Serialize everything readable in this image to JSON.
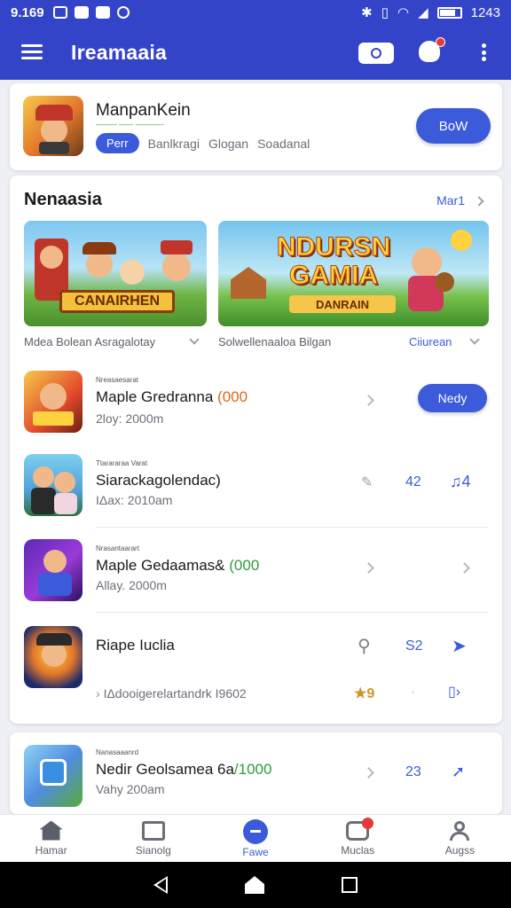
{
  "status_bar": {
    "time": "9.169",
    "clock": "1243"
  },
  "app_bar": {
    "title": "Ireamaaia"
  },
  "featured": {
    "title": "ManpanKein",
    "subtitle": "——— —— ————",
    "tag_pill": "Perr",
    "tags": [
      "Banlkragi",
      "Glogan",
      "Soadanal"
    ],
    "button": "BoW"
  },
  "section": {
    "title": "Nenaasia",
    "more": "Mar1",
    "banners": [
      {
        "plaque": "CANAIRHEN",
        "caption": "Mdea Bolean Asragalotay"
      },
      {
        "headline": "NDURSN GAMIA",
        "ribbon": "DANRAIN",
        "caption": "Solwellenaaloa Bilgan",
        "link": "Ciiurean"
      }
    ],
    "rows": [
      {
        "small": "Nreasaesarat",
        "title": "Maple Gredranna",
        "title_accent": "(000",
        "meta": "2loy: 2000m",
        "button": "Nedy"
      },
      {
        "small": "Ttarararaa Varat",
        "title": "Siarackagolendac)",
        "meta": "IΔax: 2010am",
        "num1": "42",
        "num2": "♫4"
      },
      {
        "small": "Nrasantaarart",
        "title": "Maple Gedaamas&",
        "title_accent": "(000",
        "meta": "Allay. 2000m"
      },
      {
        "title": "Riape Iuclia",
        "num1": "S2",
        "detail": "IΔdooigerelartandrk I9602",
        "rating": "★9"
      }
    ]
  },
  "bottom_card": {
    "small": "Nanasaaanrd",
    "title": "Nedir Geolsamea 6a",
    "title_accent": "/1000",
    "meta": "Vahy 200am",
    "num": "23"
  },
  "bottom_nav": [
    {
      "label": "Hamar"
    },
    {
      "label": "Sianolg"
    },
    {
      "label": "Fawe"
    },
    {
      "label": "Muclas"
    },
    {
      "label": "Augss"
    }
  ],
  "colors": {
    "app_bar": "#3444c8",
    "accent": "#3b5bdb",
    "green": "#2e9c3a",
    "orange": "#e0661c"
  }
}
